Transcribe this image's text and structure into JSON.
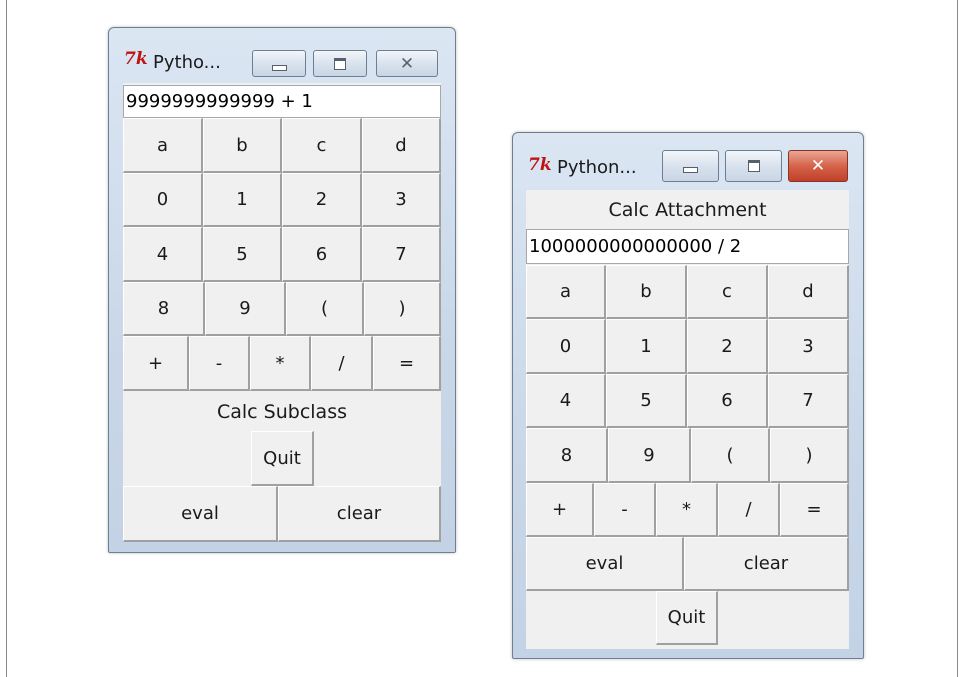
{
  "subclass_window": {
    "title": "Pytho...",
    "entry_value": "9999999999999 + 1",
    "rows": [
      [
        "a",
        "b",
        "c",
        "d"
      ],
      [
        "0",
        "1",
        "2",
        "3"
      ],
      [
        "4",
        "5",
        "6",
        "7"
      ],
      [
        "8",
        "9",
        "(",
        ")"
      ],
      [
        "+",
        "-",
        "*",
        "/",
        "="
      ]
    ],
    "caption": "Calc Subclass",
    "quit_label": "Quit",
    "eval_label": "eval",
    "clear_label": "clear"
  },
  "attachment_window": {
    "title": "Python...",
    "caption": "Calc Attachment",
    "entry_value": "1000000000000000 / 2",
    "rows": [
      [
        "a",
        "b",
        "c",
        "d"
      ],
      [
        "0",
        "1",
        "2",
        "3"
      ],
      [
        "4",
        "5",
        "6",
        "7"
      ],
      [
        "8",
        "9",
        "(",
        ")"
      ],
      [
        "+",
        "-",
        "*",
        "/",
        "="
      ]
    ],
    "eval_label": "eval",
    "clear_label": "clear",
    "quit_label": "Quit"
  },
  "icons": {
    "app_icon": "tk-feather-icon",
    "minimize": "minimize-icon",
    "maximize": "maximize-icon",
    "close": "close-icon"
  },
  "colors": {
    "tk_icon_red": "#c01414",
    "close_button_active": "#d6634a",
    "window_frame": "#c9d7e8",
    "client_bg": "#f0f0f0"
  }
}
